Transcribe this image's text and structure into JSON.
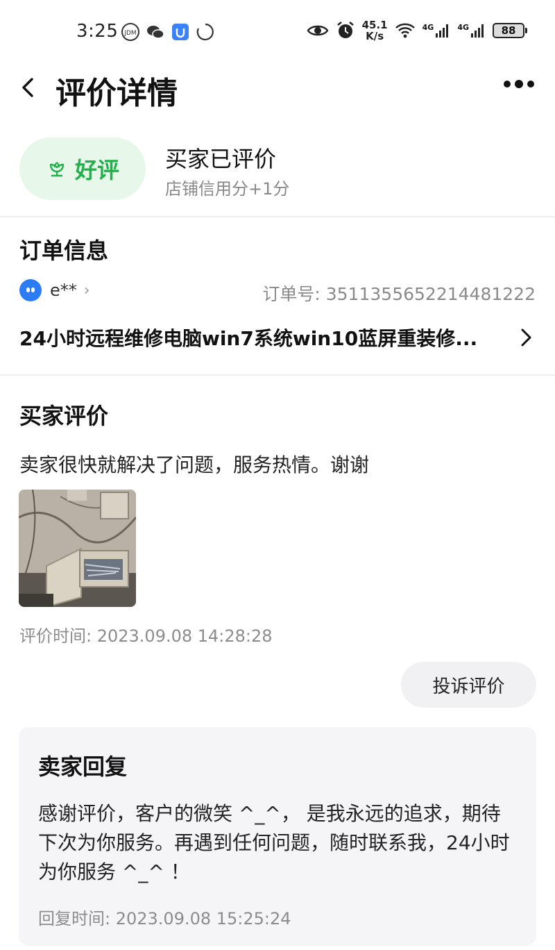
{
  "status_bar": {
    "time": "3:25",
    "speed_value": "45.1",
    "speed_unit": "K/s",
    "network_1": "4G",
    "network_2": "4G",
    "battery": "88"
  },
  "header": {
    "title": "评价详情"
  },
  "rating": {
    "badge_label": "好评",
    "title": "买家已评价",
    "subtitle": "店铺信用分+1分",
    "accent_color": "#21b14b"
  },
  "order": {
    "section_title": "订单信息",
    "buyer_name": "e**",
    "order_number": "订单号: 3511355652214481222",
    "product_name": "24小时远程维修电脑win7系统win10蓝屏重装修..."
  },
  "buyer_review": {
    "section_title": "买家评价",
    "text": "卖家很快就解决了问题，服务热情。谢谢",
    "time": "评价时间: 2023.09.08 14:28:28",
    "complain_label": "投诉评价"
  },
  "seller_reply": {
    "section_title": "卖家回复",
    "text": "感谢评价，客户的微笑 ^_^， 是我永远的追求，期待下次为你服务。再遇到任何问题，随时联系我，24小时为你服务 ^_^ ！",
    "time": "回复时间: 2023.09.08 15:25:24"
  }
}
